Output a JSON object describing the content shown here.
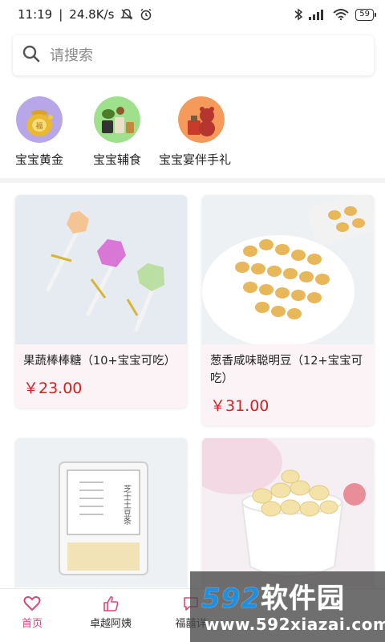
{
  "status_bar": {
    "time": "11:19",
    "speed": "24.8K/s",
    "battery": "59"
  },
  "search": {
    "placeholder": "请搜索"
  },
  "categories": [
    {
      "label": "宝宝黄金",
      "icon": "gold-bag-icon"
    },
    {
      "label": "宝宝辅食",
      "icon": "baby-food-icon"
    },
    {
      "label": "宝宝宴伴手礼",
      "icon": "gift-bear-icon"
    }
  ],
  "products": [
    {
      "title": "果蔬棒棒糖（10+宝宝可吃）",
      "price": "￥23.00"
    },
    {
      "title": "葱香咸味聪明豆（12+宝宝可吃）",
      "price": "￥31.00"
    },
    {
      "title": "",
      "price": ""
    },
    {
      "title": "",
      "price": ""
    }
  ],
  "product_images": {
    "box_label": "芝士土豆条"
  },
  "tabs": [
    {
      "label": "首页",
      "icon": "heart-icon",
      "active": true
    },
    {
      "label": "卓越阿姨",
      "icon": "thumbs-up-icon",
      "active": false
    },
    {
      "label": "福囍详",
      "icon": "chat-icon",
      "active": false
    }
  ],
  "watermark": {
    "brand_digits": "592",
    "brand_text": "软件园",
    "url": "www.592xiazai.com"
  },
  "colors": {
    "accent": "#e0457b",
    "price": "#d62020"
  }
}
